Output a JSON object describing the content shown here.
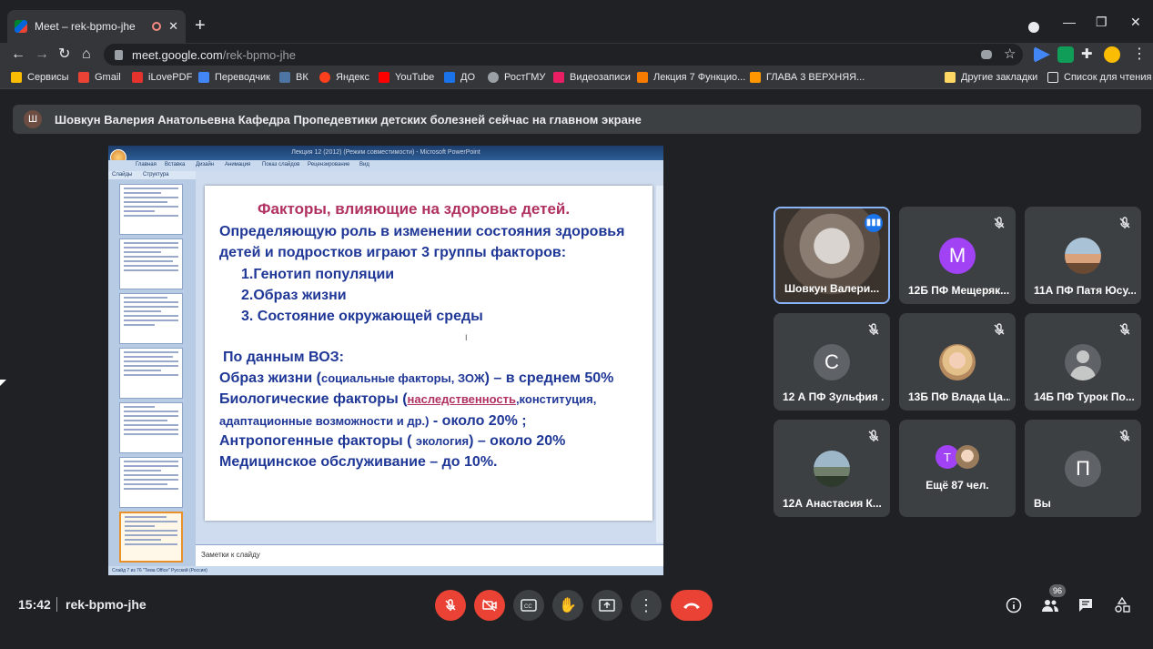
{
  "browser": {
    "tab_title": "Meet – rek-bpmo-jhe",
    "url_host": "meet.google.com",
    "url_path": "/rek-bpmo-jhe",
    "bookmarks": [
      {
        "label": "Сервисы",
        "color": "#fbbc04"
      },
      {
        "label": "Gmail",
        "color": "#ea4335"
      },
      {
        "label": "iLovePDF",
        "color": "#e5322d"
      },
      {
        "label": "Переводчик",
        "color": "#4285f4"
      },
      {
        "label": "ВК",
        "color": "#4c75a3"
      },
      {
        "label": "Яндекс",
        "color": "#fc3f1d"
      },
      {
        "label": "YouTube",
        "color": "#ff0000"
      },
      {
        "label": "ДО",
        "color": "#1a73e8"
      },
      {
        "label": "РостГМУ",
        "color": "#5f6368"
      },
      {
        "label": "Видеозаписи",
        "color": "#e91e63"
      },
      {
        "label": "Лекция 7 Функцио...",
        "color": "#f57c00"
      },
      {
        "label": "ГЛАВА 3 ВЕРХНЯЯ...",
        "color": "#ff9800"
      }
    ],
    "other_bookmarks": "Другие закладки",
    "reading_list": "Список для чтения"
  },
  "banner": {
    "avatar_letter": "Ш",
    "text": "Шовкун Валерия Анатольевна Кафедра Пропедевтики детских болезней сейчас на главном экране"
  },
  "presentation": {
    "window_title": "Лекция 12 (2012) (Режим совместимости) - Microsoft PowerPoint",
    "ribbon_tabs": [
      "Главная",
      "Вставка",
      "Дизайн",
      "Анимация",
      "Показ слайдов",
      "Рецензирование",
      "Вид"
    ],
    "panel_tabs": [
      "Слайды",
      "Структура"
    ],
    "slide": {
      "title": "Факторы, влияющие на здоровье детей.",
      "line1": "Определяющую роль  в изменении состояния здоровья",
      "line2": "детей и подростков играют 3 группы факторов:",
      "item1": "1.Генотип популяции",
      "item2": "2.Образ жизни",
      "item3": "3. Состояние окружающей среды",
      "who": "По данным ВОЗ:",
      "f1_a": "Образ жизни (",
      "f1_b": "социальные факторы, ЗОЖ",
      "f1_c": ") – в среднем 50%",
      "f2_a": "Биологические факторы (",
      "f2_b": "наследственность",
      "f2_c": ",конституция,",
      "f3_a": "адаптационные возможности и др.)",
      "f3_b": " - около 20% ;",
      "f4_a": "Антропогенные факторы ( ",
      "f4_b": "экология",
      "f4_c": ") – около 20%",
      "f5": "Медицинское обслуживание – до 10%."
    },
    "notes_placeholder": "Заметки к слайду",
    "status": "Слайд 7 из 76    \"Тема Office\"    Русский (Россия)"
  },
  "participants": [
    {
      "name": "Шовкун Валери...",
      "type": "video",
      "speaking": true
    },
    {
      "name": "12Б ПФ Мещеряк...",
      "type": "letter",
      "letter": "M",
      "color": "#a142f4"
    },
    {
      "name": "11А ПФ Патя Юсу...",
      "type": "photo"
    },
    {
      "name": "12 А ПФ Зульфия ...",
      "type": "letter",
      "letter": "С",
      "color": "#5f6368"
    },
    {
      "name": "13Б ПФ Влада Ца...",
      "type": "photo"
    },
    {
      "name": "14Б ПФ Турок По...",
      "type": "generic"
    },
    {
      "name": "12А Анастасия К...",
      "type": "photo"
    },
    {
      "name": "Ещё 87 чел.",
      "type": "more",
      "letter": "Т"
    },
    {
      "name": "Вы",
      "type": "letter",
      "letter": "П",
      "color": "#5f6368"
    }
  ],
  "bottom": {
    "time": "15:42",
    "meeting_code": "rek-bpmo-jhe",
    "people_count": "96"
  }
}
